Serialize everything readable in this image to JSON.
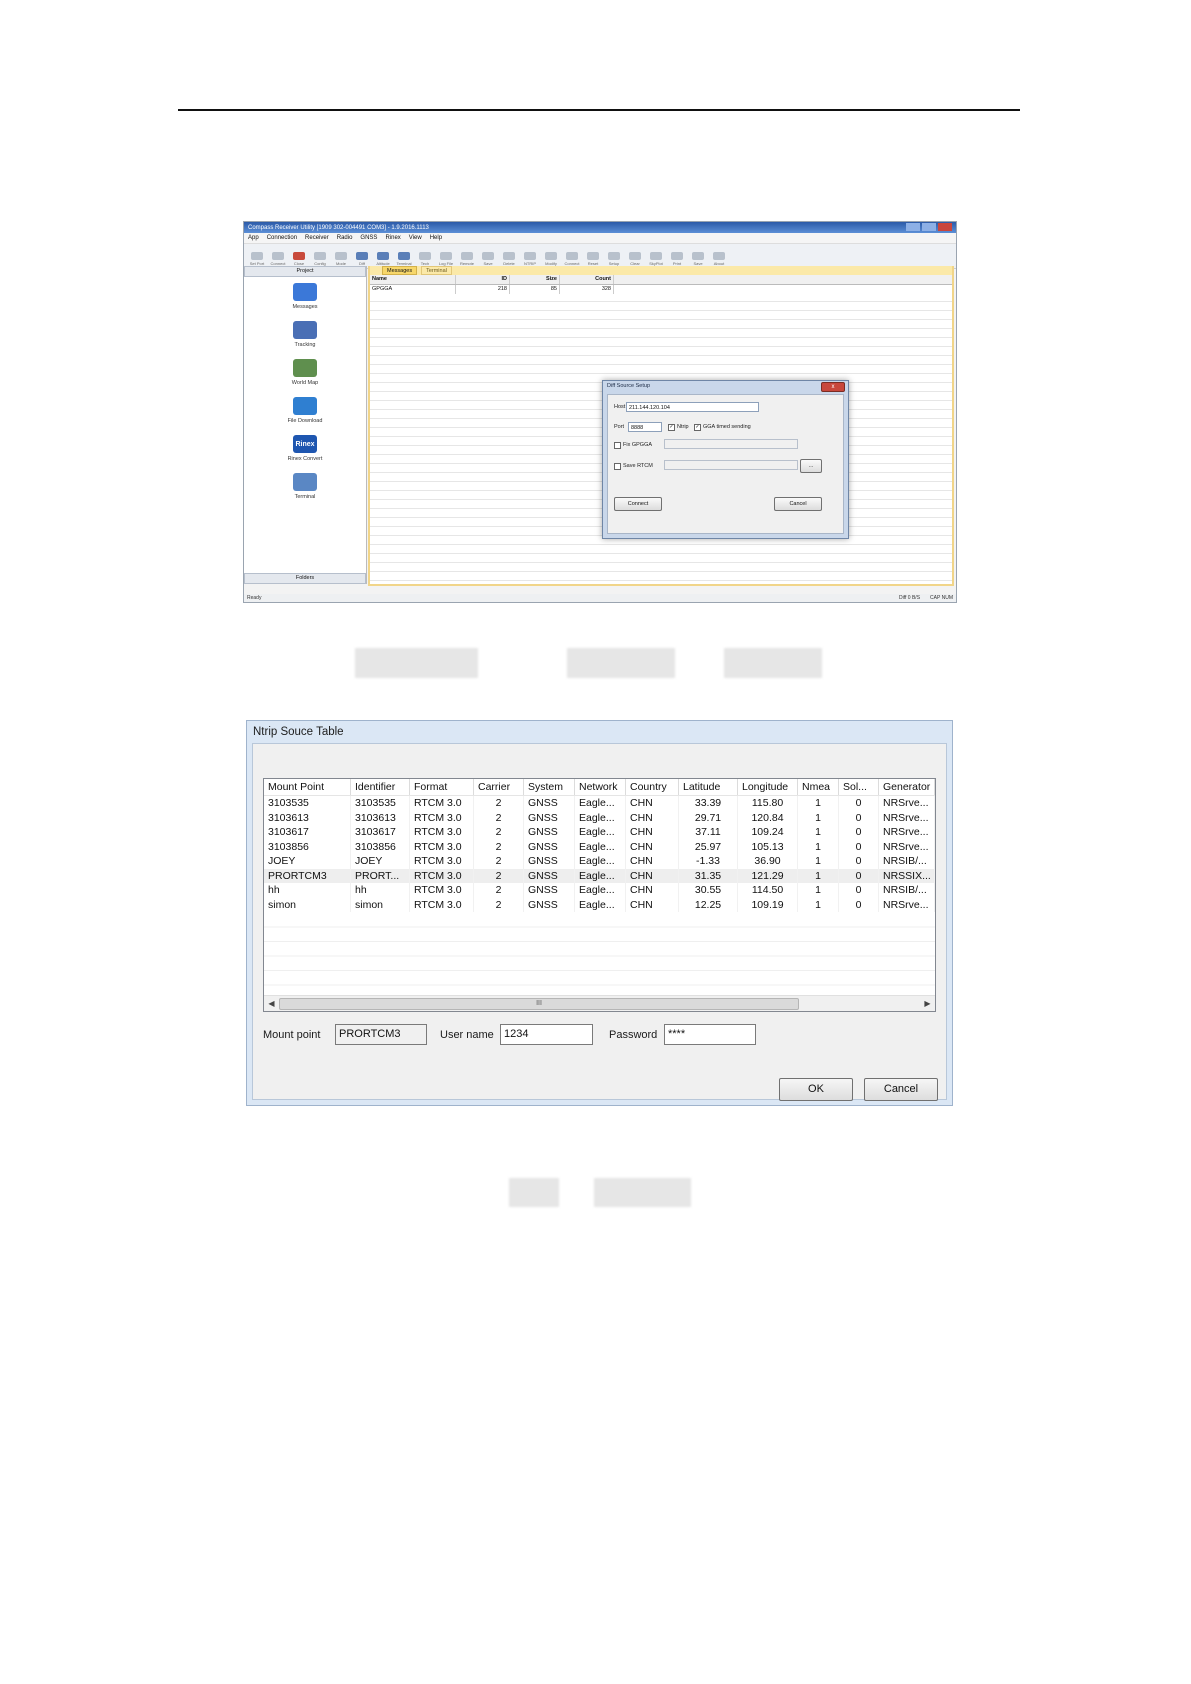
{
  "receiver_utility": {
    "window_title": "Compass Receiver Utility [1909 302-004491 COM3] - 1.9.2016.1113",
    "menu": [
      "App",
      "Connection",
      "Receiver",
      "Radio",
      "GNSS",
      "Rinex",
      "View",
      "Help"
    ],
    "toolbar": [
      {
        "label": "Set Port",
        "icon": "port-icon"
      },
      {
        "label": "Connect",
        "icon": "connect-icon"
      },
      {
        "label": "Close",
        "icon": "disconnect-icon"
      },
      {
        "label": "Config",
        "icon": "config-icon"
      },
      {
        "label": "Mode",
        "icon": "mode-icon"
      },
      {
        "label": "Diff",
        "icon": "diff-icon"
      },
      {
        "label": "Altitude",
        "icon": "altitude-icon"
      },
      {
        "label": "Terminal",
        "icon": "terminal-icon"
      },
      {
        "label": "Tech",
        "icon": "tech-icon"
      },
      {
        "label": "Log File",
        "icon": "logfile-icon"
      },
      {
        "label": "Remote",
        "icon": "remote-icon"
      },
      {
        "label": "Save",
        "icon": "save-icon"
      },
      {
        "label": "Delete",
        "icon": "delete-icon"
      },
      {
        "label": "NTRIP",
        "icon": "ntrip-icon"
      },
      {
        "label": "Modify",
        "icon": "modify-icon"
      },
      {
        "label": "Connect",
        "icon": "connect2-icon"
      },
      {
        "label": "Reset",
        "icon": "reset-icon"
      },
      {
        "label": "Setup",
        "icon": "setup-icon"
      },
      {
        "label": "Clear",
        "icon": "clear-icon"
      },
      {
        "label": "SkyPlot",
        "icon": "skyplot-icon"
      },
      {
        "label": "Print",
        "icon": "print-icon"
      },
      {
        "label": "Save",
        "icon": "save2-icon"
      },
      {
        "label": "About",
        "icon": "about-icon"
      }
    ],
    "project_header": "Project",
    "folders_header": "Folders",
    "nav": [
      {
        "label": "Messages",
        "icon": "messages-icon",
        "color": "#3b78d8"
      },
      {
        "label": "Tracking",
        "icon": "tracking-icon",
        "color": "#4a6fb5"
      },
      {
        "label": "World Map",
        "icon": "world-map-icon",
        "color": "#5f8f4e"
      },
      {
        "label": "File Download",
        "icon": "file-download-icon",
        "color": "#2f7fd1"
      },
      {
        "label": "Rinex Convert",
        "icon": "rinex-convert-icon",
        "color": "#1e56b0",
        "glyph": "Rinex"
      },
      {
        "label": "Terminal",
        "icon": "terminal-nav-icon",
        "color": "#5a87c4"
      }
    ],
    "tabs": [
      "Messages",
      "Terminal"
    ],
    "table": {
      "headers": [
        "Name",
        "ID",
        "Size",
        "Count"
      ],
      "rows": [
        [
          "GPGGA",
          "218",
          "85",
          "328"
        ]
      ]
    },
    "status": {
      "left": "Ready",
      "diff": "Diff 0 B/S",
      "indicators": "CAP NUM"
    },
    "dialog": {
      "title": "Diff Source Setup",
      "host_label": "Host",
      "host_value": "211.144.120.104",
      "port_label": "Port",
      "port_value": "8888",
      "ntrip_label": "Ntrip",
      "gga_label": "GGA timed sending",
      "fix_label": "Fix GPGGA",
      "save_label": "Save RTCM",
      "browse_label": "...",
      "connect_label": "Connect",
      "cancel_label": "Cancel"
    }
  },
  "ntrip_table": {
    "title": "Ntrip Souce Table",
    "headers": [
      "Mount Point",
      "Identifier",
      "Format",
      "Carrier",
      "System",
      "Network",
      "Country",
      "Latitude",
      "Longitude",
      "Nmea",
      "Sol...",
      "Generator"
    ],
    "rows": [
      [
        "3103535",
        "3103535",
        "RTCM 3.0",
        "2",
        "GNSS",
        "Eagle...",
        "CHN",
        "33.39",
        "115.80",
        "1",
        "0",
        "NRSrve..."
      ],
      [
        "3103613",
        "3103613",
        "RTCM 3.0",
        "2",
        "GNSS",
        "Eagle...",
        "CHN",
        "29.71",
        "120.84",
        "1",
        "0",
        "NRSrve..."
      ],
      [
        "3103617",
        "3103617",
        "RTCM 3.0",
        "2",
        "GNSS",
        "Eagle...",
        "CHN",
        "37.11",
        "109.24",
        "1",
        "0",
        "NRSrve..."
      ],
      [
        "3103856",
        "3103856",
        "RTCM 3.0",
        "2",
        "GNSS",
        "Eagle...",
        "CHN",
        "25.97",
        "105.13",
        "1",
        "0",
        "NRSrve..."
      ],
      [
        "JOEY",
        "JOEY",
        "RTCM 3.0",
        "2",
        "GNSS",
        "Eagle...",
        "CHN",
        "-1.33",
        "36.90",
        "1",
        "0",
        "NRSIB/..."
      ],
      [
        "PRORTCM3",
        "PRORT...",
        "RTCM 3.0",
        "2",
        "GNSS",
        "Eagle...",
        "CHN",
        "31.35",
        "121.29",
        "1",
        "0",
        "NRSSIX..."
      ],
      [
        "hh",
        "hh",
        "RTCM 3.0",
        "2",
        "GNSS",
        "Eagle...",
        "CHN",
        "30.55",
        "114.50",
        "1",
        "0",
        "NRSIB/..."
      ],
      [
        "simon",
        "simon",
        "RTCM 3.0",
        "2",
        "GNSS",
        "Eagle...",
        "CHN",
        "12.25",
        "109.19",
        "1",
        "0",
        "NRSrve..."
      ]
    ],
    "selected_row": 5,
    "scroll_grip": "III",
    "mount_point_label": "Mount point",
    "mount_point_value": "PRORTCM3",
    "username_label": "User name",
    "username_value": "1234",
    "password_label": "Password",
    "password_value": "****",
    "ok_label": "OK",
    "cancel_label": "Cancel"
  }
}
